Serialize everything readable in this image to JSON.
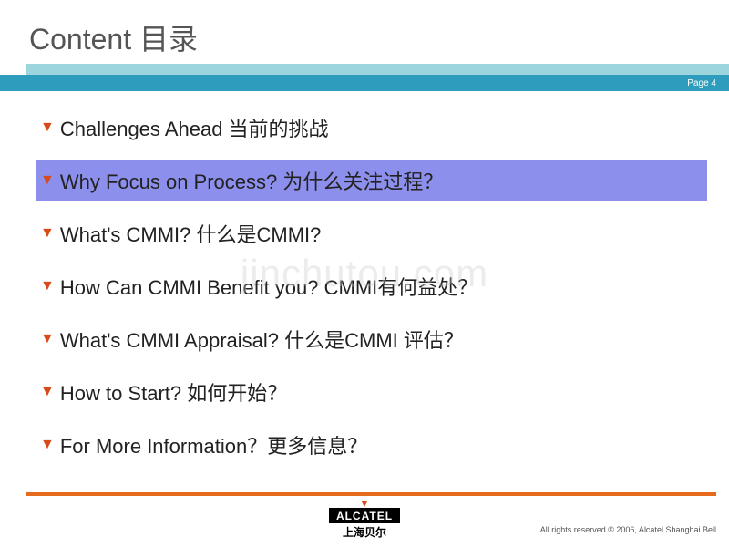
{
  "title": "Content  目录",
  "page_label": "Page  4",
  "watermark": "jinchutou.com",
  "items": [
    {
      "text": "Challenges Ahead 当前的挑战",
      "highlighted": false
    },
    {
      "text": "Why Focus on Process? 为什么关注过程？",
      "highlighted": true
    },
    {
      "text": "What's CMMI? 什么是CMMI?",
      "highlighted": false
    },
    {
      "text": "How Can CMMI Benefit you? CMMI有何益处？",
      "highlighted": false
    },
    {
      "text": "What's CMMI Appraisal? 什么是CMMI 评估？",
      "highlighted": false
    },
    {
      "text": "How to Start? 如何开始？",
      "highlighted": false
    },
    {
      "text": "For More Information？更多信息？",
      "highlighted": false
    }
  ],
  "logo_top": "ALCATEL",
  "logo_bottom": "上海贝尔",
  "copyright": "All rights reserved © 2006, Alcatel Shanghai Bell"
}
